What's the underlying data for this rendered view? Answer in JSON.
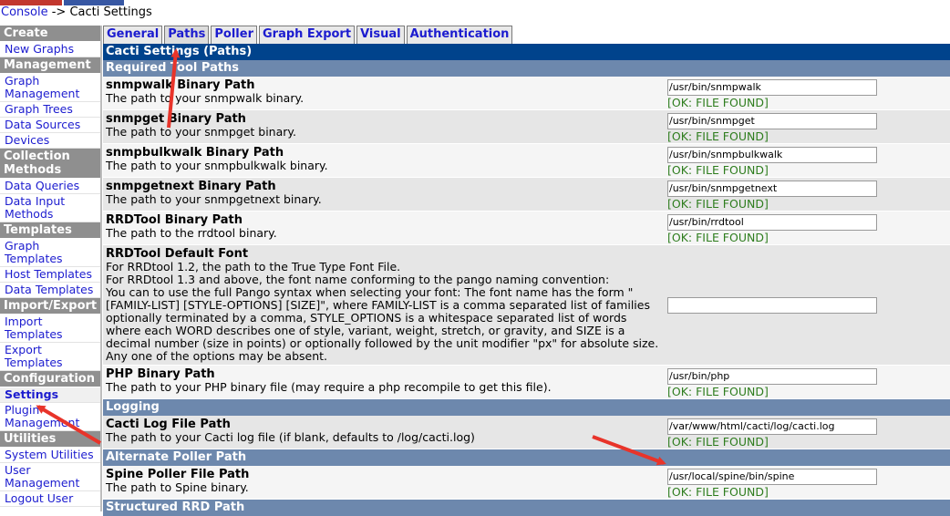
{
  "breadcrumb": {
    "console": "Console",
    "separator": " -> ",
    "current": "Cacti Settings"
  },
  "sidebar": [
    {
      "type": "header",
      "label": "Create"
    },
    {
      "type": "item",
      "label": "New Graphs"
    },
    {
      "type": "header",
      "label": "Management"
    },
    {
      "type": "item",
      "label": "Graph Management"
    },
    {
      "type": "item",
      "label": "Graph Trees"
    },
    {
      "type": "item",
      "label": "Data Sources"
    },
    {
      "type": "item",
      "label": "Devices"
    },
    {
      "type": "header",
      "label": "Collection Methods"
    },
    {
      "type": "item",
      "label": "Data Queries"
    },
    {
      "type": "item",
      "label": "Data Input Methods"
    },
    {
      "type": "header",
      "label": "Templates"
    },
    {
      "type": "item",
      "label": "Graph Templates"
    },
    {
      "type": "item",
      "label": "Host Templates"
    },
    {
      "type": "item",
      "label": "Data Templates"
    },
    {
      "type": "header",
      "label": "Import/Export"
    },
    {
      "type": "item",
      "label": "Import Templates"
    },
    {
      "type": "item",
      "label": "Export Templates"
    },
    {
      "type": "header",
      "label": "Configuration"
    },
    {
      "type": "item",
      "label": "Settings",
      "active": true
    },
    {
      "type": "item",
      "label": "Plugin Management"
    },
    {
      "type": "header",
      "label": "Utilities"
    },
    {
      "type": "item",
      "label": "System Utilities"
    },
    {
      "type": "item",
      "label": "User Management"
    },
    {
      "type": "item",
      "label": "Logout User"
    }
  ],
  "tabs": [
    {
      "label": "General",
      "active": false
    },
    {
      "label": "Paths",
      "active": true
    },
    {
      "label": "Poller",
      "active": false
    },
    {
      "label": "Graph Export",
      "active": false
    },
    {
      "label": "Visual",
      "active": false
    },
    {
      "label": "Authentication",
      "active": false
    }
  ],
  "title": "Cacti Settings (Paths)",
  "status_ok": "[OK: FILE FOUND]",
  "colors": {
    "title": "#00438c",
    "section": "#6d88ad",
    "ok": "#2e7d1e",
    "link": "#1c1ccf",
    "arrow": "#e8342a"
  },
  "content": [
    {
      "kind": "section",
      "label": "Required Tool Paths"
    },
    {
      "kind": "row",
      "id": "snmpwalk",
      "name": "snmpwalk Binary Path",
      "desc": [
        "The path to your snmpwalk binary."
      ],
      "value": "/usr/bin/snmpwalk",
      "ok": true
    },
    {
      "kind": "row",
      "id": "snmpget",
      "name": "snmpget Binary Path",
      "desc": [
        "The path to your snmpget binary."
      ],
      "value": "/usr/bin/snmpget",
      "ok": true
    },
    {
      "kind": "row",
      "id": "snmpbulkwalk",
      "name": "snmpbulkwalk Binary Path",
      "desc": [
        "The path to your snmpbulkwalk binary."
      ],
      "value": "/usr/bin/snmpbulkwalk",
      "ok": true
    },
    {
      "kind": "row",
      "id": "snmpgetnext",
      "name": "snmpgetnext Binary Path",
      "desc": [
        "The path to your snmpgetnext binary."
      ],
      "value": "/usr/bin/snmpgetnext",
      "ok": true
    },
    {
      "kind": "row",
      "id": "rrdtool",
      "name": "RRDTool Binary Path",
      "desc": [
        "The path to the rrdtool binary."
      ],
      "value": "/usr/bin/rrdtool",
      "ok": true
    },
    {
      "kind": "row",
      "id": "rrdtool-font",
      "name": "RRDTool Default Font",
      "desc": [
        "For RRDtool 1.2, the path to the True Type Font File.",
        "For RRDtool 1.3 and above, the font name conforming to the pango naming convention:",
        "You can to use the full Pango syntax when selecting your font: The font name has the form \"",
        "[FAMILY-LIST] [STYLE-OPTIONS] [SIZE]\", where FAMILY-LIST is a comma separated list of families",
        "optionally terminated by a comma, STYLE_OPTIONS is a whitespace separated list of words",
        "where each WORD describes one of style, variant, weight, stretch, or gravity, and SIZE is a",
        "decimal number (size in points) or optionally followed by the unit modifier \"px\" for absolute size.",
        "Any one of the options may be absent."
      ],
      "value": "",
      "ok": false
    },
    {
      "kind": "row",
      "id": "php",
      "name": "PHP Binary Path",
      "desc": [
        "The path to your PHP binary file (may require a php recompile to get this file)."
      ],
      "value": "/usr/bin/php",
      "ok": true
    },
    {
      "kind": "section",
      "label": "Logging"
    },
    {
      "kind": "row",
      "id": "cacti-log",
      "name": "Cacti Log File Path",
      "desc": [
        "The path to your Cacti log file (if blank, defaults to /log/cacti.log)"
      ],
      "value": "/var/www/html/cacti/log/cacti.log",
      "ok": true
    },
    {
      "kind": "section",
      "label": "Alternate Poller Path"
    },
    {
      "kind": "row",
      "id": "spine",
      "name": "Spine Poller File Path",
      "desc": [
        "The path to Spine binary."
      ],
      "value": "/usr/local/spine/bin/spine",
      "ok": true
    },
    {
      "kind": "section",
      "label": "Structured RRD Path"
    }
  ]
}
